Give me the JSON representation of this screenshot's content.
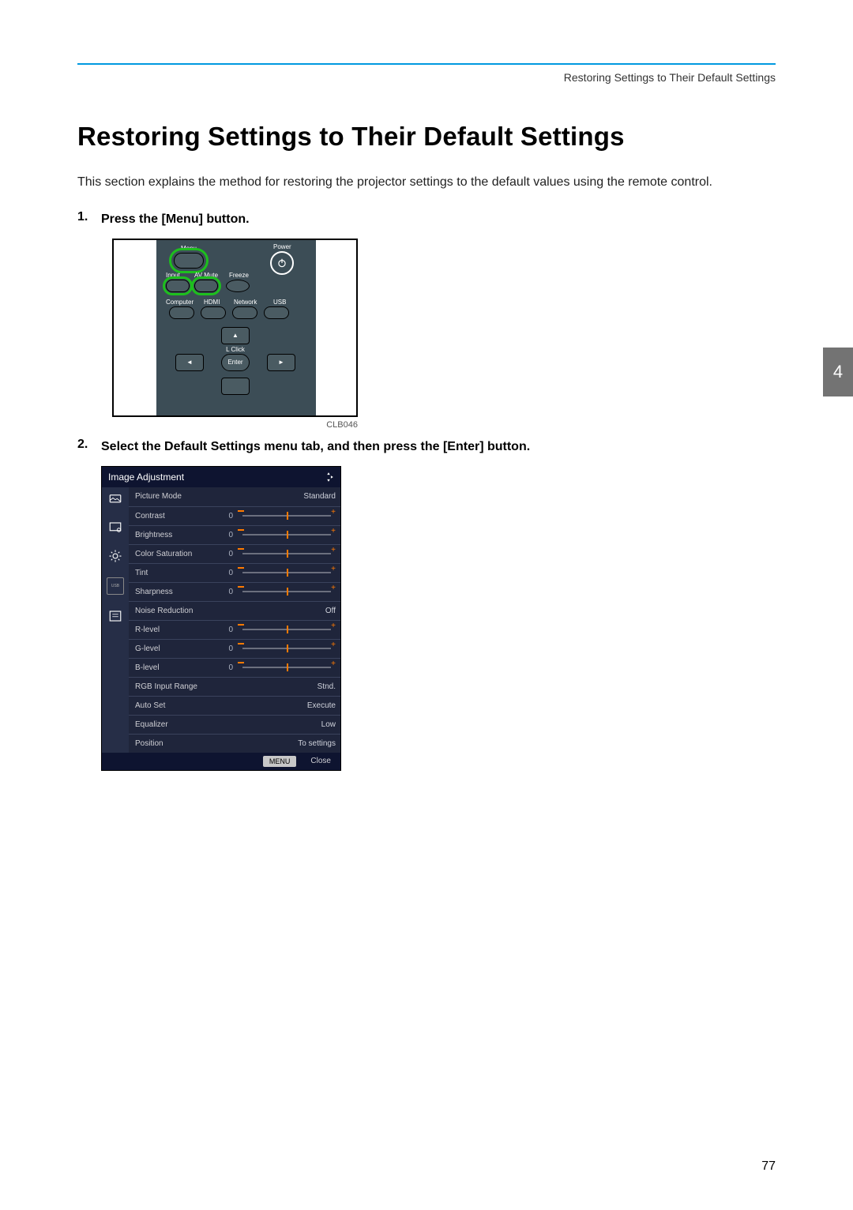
{
  "header_text": "Restoring Settings to Their Default Settings",
  "title": "Restoring Settings to Their Default Settings",
  "intro": "This section explains the method for restoring the projector settings to the default values using the remote control.",
  "steps": [
    "Press the [Menu] button.",
    "Select the Default Settings menu tab, and then press the [Enter] button."
  ],
  "remote": {
    "labels": {
      "menu": "Menu",
      "power": "Power",
      "input": "Input",
      "avmute": "AV Mute",
      "freeze": "Freeze",
      "computer": "Computer",
      "hdmi": "HDMI",
      "network": "Network",
      "usb": "USB",
      "lclick": "L Click",
      "enter": "Enter"
    },
    "caption": "CLB046"
  },
  "osd": {
    "title": "Image Adjustment",
    "rows": [
      {
        "name": "Picture Mode",
        "type": "text",
        "value": "Standard"
      },
      {
        "name": "Contrast",
        "type": "slider",
        "value": "0"
      },
      {
        "name": "Brightness",
        "type": "slider",
        "value": "0"
      },
      {
        "name": "Color Saturation",
        "type": "slider",
        "value": "0"
      },
      {
        "name": "Tint",
        "type": "slider",
        "value": "0"
      },
      {
        "name": "Sharpness",
        "type": "slider",
        "value": "0"
      },
      {
        "name": "Noise Reduction",
        "type": "text",
        "value": "Off"
      },
      {
        "name": "R-level",
        "type": "slider",
        "value": "0"
      },
      {
        "name": "G-level",
        "type": "slider",
        "value": "0"
      },
      {
        "name": "B-level",
        "type": "slider",
        "value": "0"
      },
      {
        "name": "RGB Input Range",
        "type": "text",
        "value": "Stnd."
      },
      {
        "name": "Auto Set",
        "type": "text",
        "value": "Execute"
      },
      {
        "name": "Equalizer",
        "type": "text",
        "value": "Low"
      },
      {
        "name": "Position",
        "type": "text",
        "value": "To settings"
      }
    ],
    "footer": {
      "menu": "MENU",
      "close": "Close"
    }
  },
  "chapter_tab": "4",
  "page_number": "77"
}
